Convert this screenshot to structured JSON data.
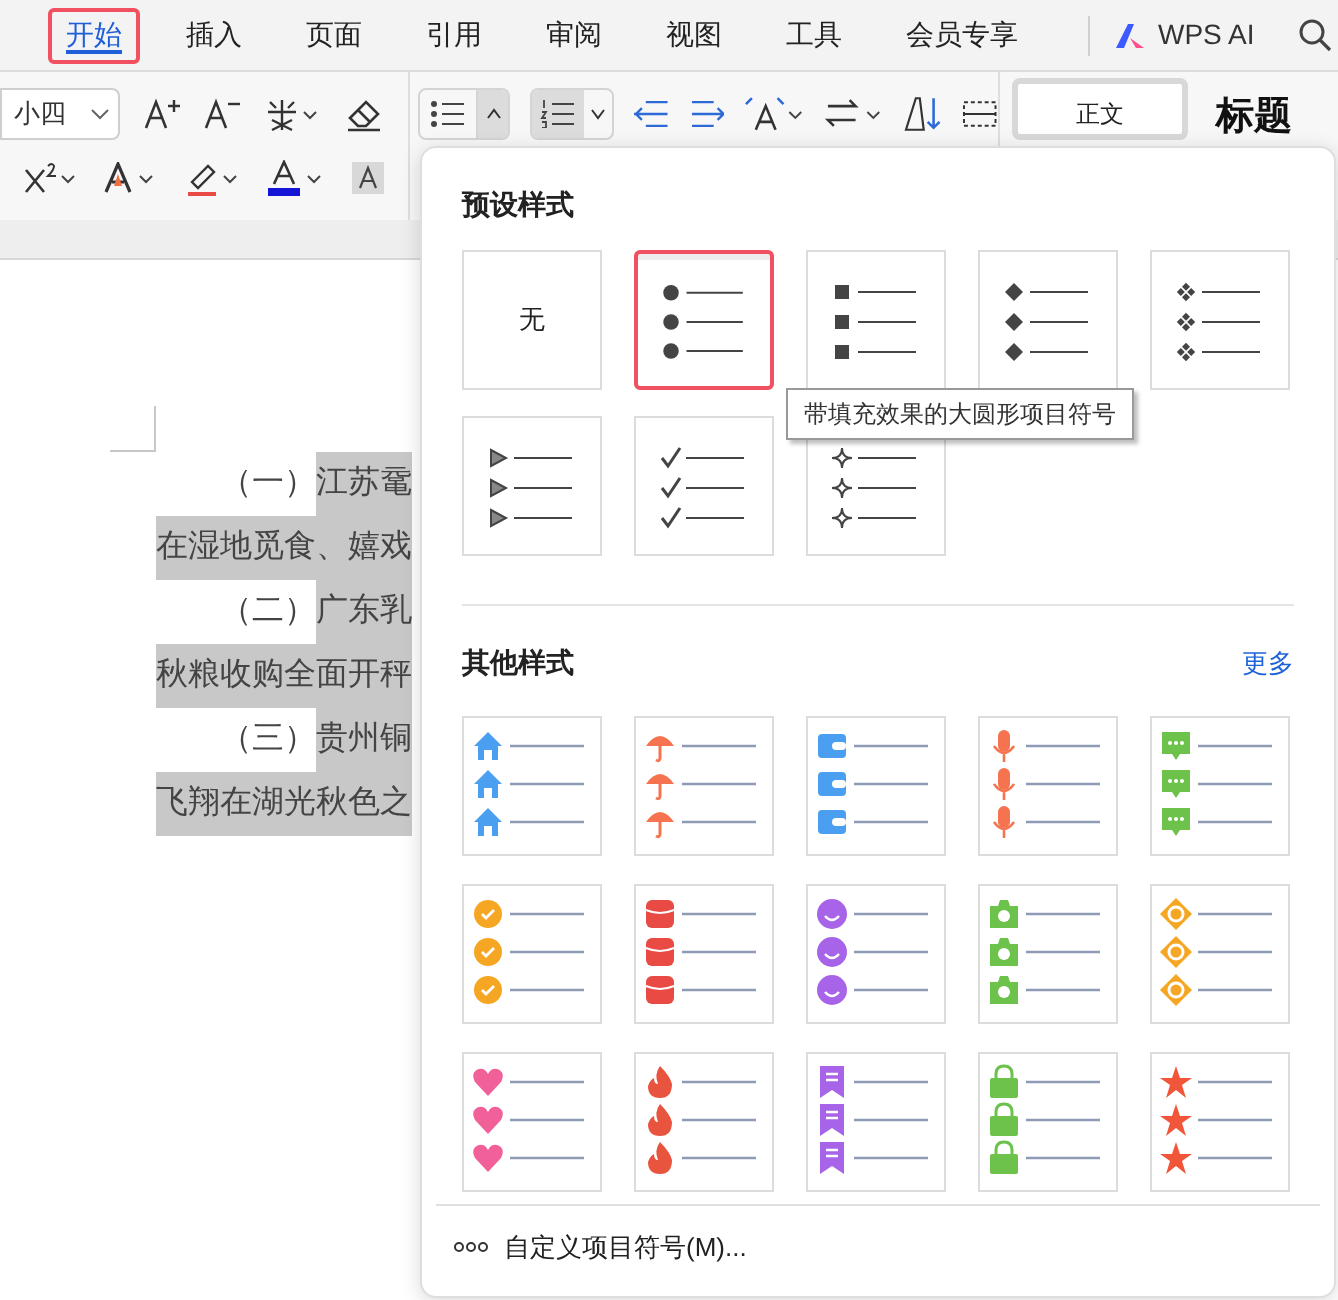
{
  "tabs": [
    {
      "label": "开始",
      "selected": true
    },
    {
      "label": "插入",
      "selected": false
    },
    {
      "label": "页面",
      "selected": false
    },
    {
      "label": "引用",
      "selected": false
    },
    {
      "label": "审阅",
      "selected": false
    },
    {
      "label": "视图",
      "selected": false
    },
    {
      "label": "工具",
      "selected": false
    },
    {
      "label": "会员专享",
      "selected": false
    }
  ],
  "ai_button": {
    "label": "WPS AI"
  },
  "toolbar": {
    "font_size": "小四",
    "bullet_list_pressed": true,
    "styles": [
      {
        "label": "正文"
      },
      {
        "label": "标题"
      }
    ]
  },
  "document": {
    "lines": [
      {
        "segments": [
          {
            "text": "（一）",
            "highlighted": false
          },
          {
            "text": "江苏鼋",
            "highlighted": true
          }
        ]
      },
      {
        "segments": [
          {
            "text": "在湿地觅食、嬉戏",
            "highlighted": true
          }
        ]
      },
      {
        "segments": [
          {
            "text": "（二）",
            "highlighted": false
          },
          {
            "text": "广东乳",
            "highlighted": true
          }
        ]
      },
      {
        "segments": [
          {
            "text": "秋粮收购全面开秤",
            "highlighted": true
          }
        ]
      },
      {
        "segments": [
          {
            "text": "（三）",
            "highlighted": false
          },
          {
            "text": "贵州铜",
            "highlighted": true
          }
        ]
      },
      {
        "segments": [
          {
            "text": "飞翔在湖光秋色之",
            "highlighted": true
          }
        ]
      }
    ]
  },
  "bullet_panel": {
    "preset_title": "预设样式",
    "presets": [
      {
        "kind": "none",
        "label": "无",
        "selected": false
      },
      {
        "kind": "dot",
        "selected": true
      },
      {
        "kind": "square",
        "selected": false
      },
      {
        "kind": "diamond",
        "selected": false
      },
      {
        "kind": "clover",
        "selected": false
      },
      {
        "kind": "arrow",
        "selected": false
      },
      {
        "kind": "check",
        "selected": false
      },
      {
        "kind": "star4",
        "selected": false
      }
    ],
    "tooltip": "带填充效果的大圆形项目符号",
    "other_title": "其他样式",
    "more_link": "更多",
    "others": [
      {
        "kind": "house",
        "color": "#4a9ff0"
      },
      {
        "kind": "umbrella",
        "color": "#f5734e"
      },
      {
        "kind": "wallet",
        "color": "#4a9ff0"
      },
      {
        "kind": "mic",
        "color": "#f5734e"
      },
      {
        "kind": "chat",
        "color": "#6cc24a"
      },
      {
        "kind": "badge",
        "color": "#f5a623"
      },
      {
        "kind": "box",
        "color": "#e94a43"
      },
      {
        "kind": "smiley",
        "color": "#a764e8"
      },
      {
        "kind": "camera",
        "color": "#6cc24a"
      },
      {
        "kind": "target",
        "color": "#f5a623"
      },
      {
        "kind": "heart",
        "color": "#f2609a"
      },
      {
        "kind": "flame",
        "color": "#e9543f"
      },
      {
        "kind": "bookmark",
        "color": "#a764e8"
      },
      {
        "kind": "bag",
        "color": "#6cc24a"
      },
      {
        "kind": "star",
        "color": "#f2563a"
      }
    ],
    "custom_option": "自定义项目符号(M)..."
  }
}
